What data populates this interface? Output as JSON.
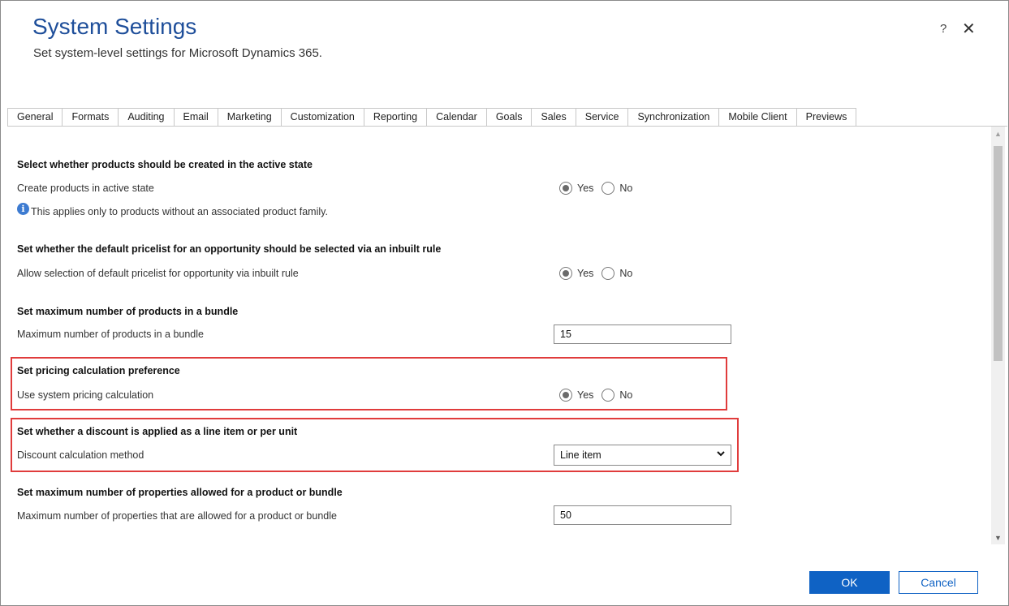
{
  "header": {
    "title": "System Settings",
    "subtitle": "Set system-level settings for Microsoft Dynamics 365.",
    "help_label": "?",
    "close_label": "✕"
  },
  "tabs": [
    {
      "label": "General"
    },
    {
      "label": "Formats"
    },
    {
      "label": "Auditing"
    },
    {
      "label": "Email"
    },
    {
      "label": "Marketing"
    },
    {
      "label": "Customization"
    },
    {
      "label": "Reporting"
    },
    {
      "label": "Calendar"
    },
    {
      "label": "Goals"
    },
    {
      "label": "Sales"
    },
    {
      "label": "Service"
    },
    {
      "label": "Synchronization"
    },
    {
      "label": "Mobile Client"
    },
    {
      "label": "Previews"
    }
  ],
  "active_tab": "Sales",
  "settings": {
    "active_state": {
      "title": "Select whether products should be created in the active state",
      "label": "Create products in active state",
      "selected": "Yes",
      "yes": "Yes",
      "no": "No",
      "note": "This applies only to products without an associated product family."
    },
    "default_pricelist": {
      "title": "Set whether the default pricelist for an opportunity should be selected via an inbuilt rule",
      "label": "Allow selection of default pricelist for opportunity via inbuilt rule",
      "selected": "Yes",
      "yes": "Yes",
      "no": "No"
    },
    "bundle_max": {
      "title": "Set maximum number of products in a bundle",
      "label": "Maximum number of products in a bundle",
      "value": "15"
    },
    "pricing_calc": {
      "title": "Set pricing calculation preference",
      "label": "Use system pricing calculation",
      "selected": "Yes",
      "yes": "Yes",
      "no": "No"
    },
    "discount": {
      "title": "Set whether a discount is applied as a line item or per unit",
      "label": "Discount calculation method",
      "value": "Line item"
    },
    "properties_max": {
      "title": "Set maximum number of properties allowed for a product or bundle",
      "label": "Maximum number of properties that are allowed for a product or bundle",
      "value": "50"
    }
  },
  "footer": {
    "ok_label": "OK",
    "cancel_label": "Cancel"
  },
  "colors": {
    "title": "#1e4e9a",
    "primary_button": "#0f62c4",
    "highlight": "#e03c3c"
  },
  "icons": {
    "info": "info-icon",
    "help": "help-icon",
    "close": "close-icon",
    "dropdown": "chevron-down-icon"
  }
}
